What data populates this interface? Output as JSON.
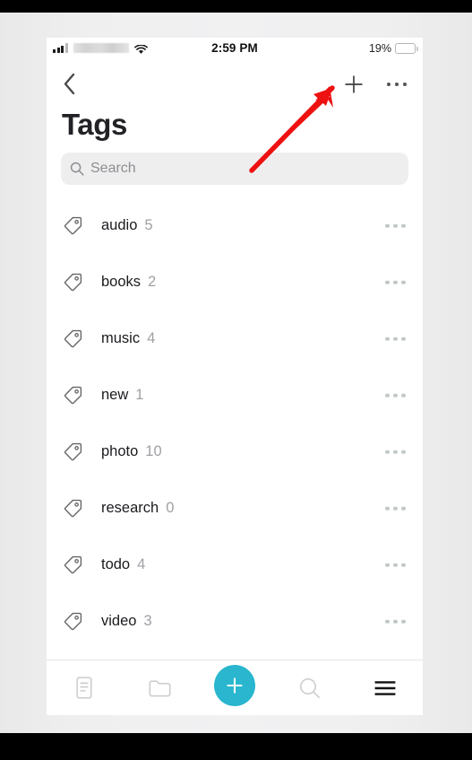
{
  "statusbar": {
    "time": "2:59 PM",
    "battery_percent": "19%",
    "battery_level": 19,
    "carrier": "",
    "signal_icon": "cellular-signal-icon",
    "wifi_icon": "wifi-icon",
    "battery_icon": "battery-icon"
  },
  "navbar": {
    "back_icon": "chevron-left-icon",
    "add_icon": "plus-icon",
    "more_icon": "ellipsis-icon"
  },
  "header": {
    "title": "Tags"
  },
  "search": {
    "placeholder": "Search",
    "value": "",
    "icon": "search-icon"
  },
  "tags": [
    {
      "name": "audio",
      "count": "5",
      "icon": "tag-icon",
      "more_icon": "ellipsis-icon"
    },
    {
      "name": "books",
      "count": "2",
      "icon": "tag-icon",
      "more_icon": "ellipsis-icon"
    },
    {
      "name": "music",
      "count": "4",
      "icon": "tag-icon",
      "more_icon": "ellipsis-icon"
    },
    {
      "name": "new",
      "count": "1",
      "icon": "tag-icon",
      "more_icon": "ellipsis-icon"
    },
    {
      "name": "photo",
      "count": "10",
      "icon": "tag-icon",
      "more_icon": "ellipsis-icon"
    },
    {
      "name": "research",
      "count": "0",
      "icon": "tag-icon",
      "more_icon": "ellipsis-icon"
    },
    {
      "name": "todo",
      "count": "4",
      "icon": "tag-icon",
      "more_icon": "ellipsis-icon"
    },
    {
      "name": "video",
      "count": "3",
      "icon": "tag-icon",
      "more_icon": "ellipsis-icon"
    }
  ],
  "tabbar": {
    "items": [
      {
        "icon": "notes-icon",
        "active": false
      },
      {
        "icon": "folder-icon",
        "active": false
      },
      {
        "icon": "plus-icon",
        "active": false
      },
      {
        "icon": "search-icon",
        "active": false
      },
      {
        "icon": "menu-icon",
        "active": true
      }
    ],
    "fab_color": "#29b6ce"
  },
  "annotation": {
    "arrow_color": "#ee1111",
    "points_to": "plus-icon"
  },
  "colors": {
    "accent": "#29b6ce",
    "text_primary": "#1b1b1f",
    "text_secondary": "#a0a0a5",
    "search_bg": "#eeeeef",
    "battery_red": "#f5222d"
  }
}
